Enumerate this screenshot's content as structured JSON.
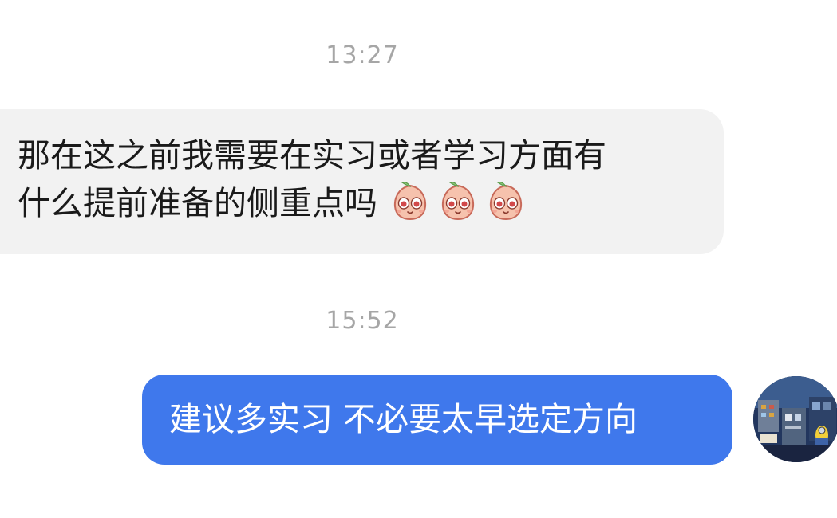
{
  "conversation": {
    "timestamps": [
      "13:27",
      "15:52"
    ],
    "incoming_message": {
      "line1": "那在这之前我需要在实习或者学习方面有",
      "line2": "什么提前准备的侧重点吗",
      "emojis": [
        "peach-sticker-emoji",
        "peach-sticker-emoji",
        "peach-sticker-emoji"
      ]
    },
    "outgoing_message": {
      "text": "建议多实习 不必要太早选定方向"
    },
    "colors": {
      "outgoing_bubble": "#3f78ec",
      "incoming_bubble": "#f2f2f2",
      "timestamp": "#a6a6a6"
    }
  }
}
